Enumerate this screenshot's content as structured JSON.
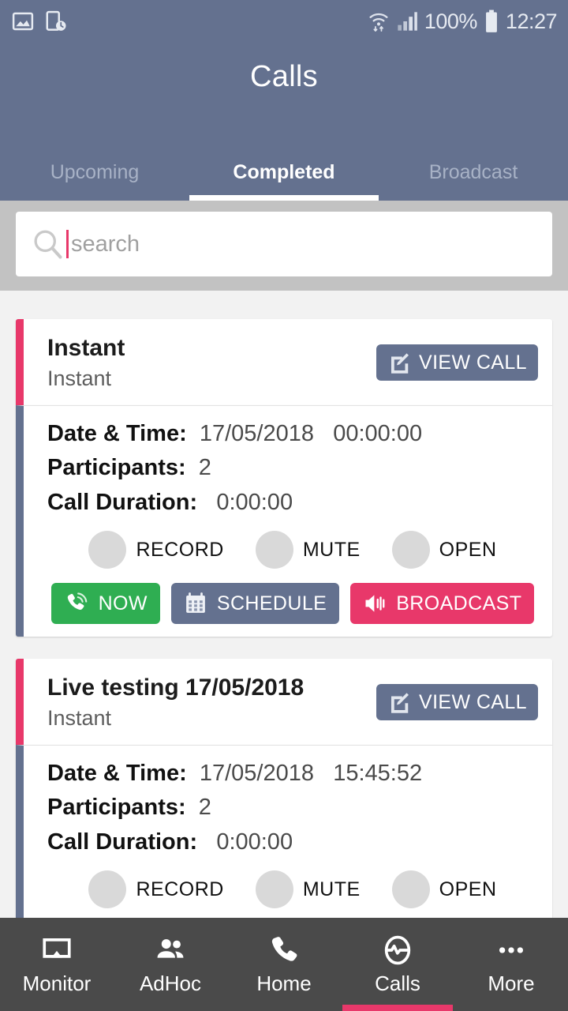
{
  "statusbar": {
    "left_icons": [
      "image-icon",
      "device-clock-icon"
    ],
    "wifi_icon": "wifi-icon",
    "signal_icon": "signal-bars-icon",
    "battery_percent": "100%",
    "battery_icon": "battery-full-icon",
    "time": "12:27"
  },
  "header": {
    "title": "Calls",
    "tabs": [
      {
        "label": "Upcoming",
        "active": false
      },
      {
        "label": "Completed",
        "active": true
      },
      {
        "label": "Broadcast",
        "active": false
      }
    ]
  },
  "search": {
    "icon": "search-icon",
    "placeholder": "search",
    "value": ""
  },
  "labels": {
    "date_time": "Date & Time:",
    "participants": "Participants:",
    "call_duration": "Call Duration:",
    "view_call": "VIEW CALL",
    "record": "RECORD",
    "mute": "MUTE",
    "open": "OPEN",
    "now": "NOW",
    "schedule": "SCHEDULE",
    "broadcast": "BROADCAST"
  },
  "calls": [
    {
      "title": "Instant",
      "subtitle": "Instant",
      "date": "17/05/2018",
      "time": "00:00:00",
      "participants": "2",
      "duration": "0:00:00"
    },
    {
      "title": "Live testing 17/05/2018",
      "subtitle": "Instant",
      "date": "17/05/2018",
      "time": "15:45:52",
      "participants": "2",
      "duration": "0:00:00"
    }
  ],
  "bottomnav": [
    {
      "label": "Monitor",
      "icon": "cast-icon",
      "active": false
    },
    {
      "label": "AdHoc",
      "icon": "people-icon",
      "active": false
    },
    {
      "label": "Home",
      "icon": "phone-icon",
      "active": false
    },
    {
      "label": "Calls",
      "icon": "pulse-circle-icon",
      "active": true
    },
    {
      "label": "More",
      "icon": "more-dots-icon",
      "active": false
    }
  ],
  "colors": {
    "header": "#64718f",
    "accent_pink": "#e8386a",
    "green": "#2fae52",
    "nav_bg": "#4a4a4a",
    "search_band": "#c2c2c2"
  }
}
